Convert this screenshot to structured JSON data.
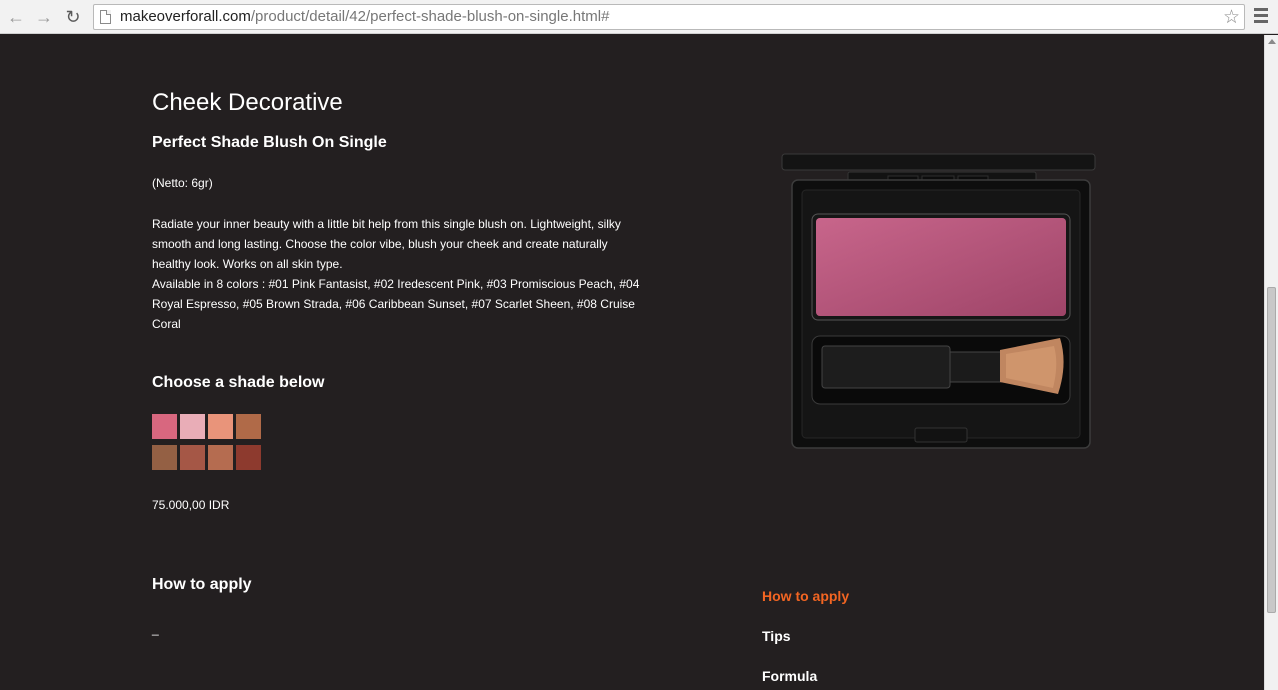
{
  "browser": {
    "url_host": "makeoverforall.com",
    "url_path": "/product/detail/42/perfect-shade-blush-on-single.html#"
  },
  "product": {
    "category": "Cheek Decorative",
    "name": "Perfect Shade Blush On Single",
    "netto": "(Netto: 6gr)",
    "description_1": "Radiate your inner beauty with a little bit help from this single blush on. Lightweight, silky smooth and long lasting. Choose the color vibe, blush your cheek and create naturally healthy look. Works on all skin type.",
    "description_2": "Available in 8 colors : #01 Pink Fantasist, #02 Iredescent Pink, #03 Promiscious Peach, #04 Royal Espresso, #05 Brown Strada, #06 Caribbean Sunset, #07 Scarlet Sheen, #08 Cruise Coral",
    "shade_title": "Choose a shade below",
    "swatch_colors": [
      "#d8677f",
      "#e9adb7",
      "#e9947a",
      "#b06a48",
      "#946044",
      "#a55746",
      "#b56c50",
      "#8d3a2e"
    ],
    "price": "75.000,00 IDR",
    "how_title": "How to apply",
    "how_text": "_"
  },
  "side_tabs": {
    "how": "How to apply",
    "tips": "Tips",
    "formula": "Formula"
  },
  "colors": {
    "background": "#231f20",
    "accent": "#f26522",
    "blush": "#b8547a"
  }
}
